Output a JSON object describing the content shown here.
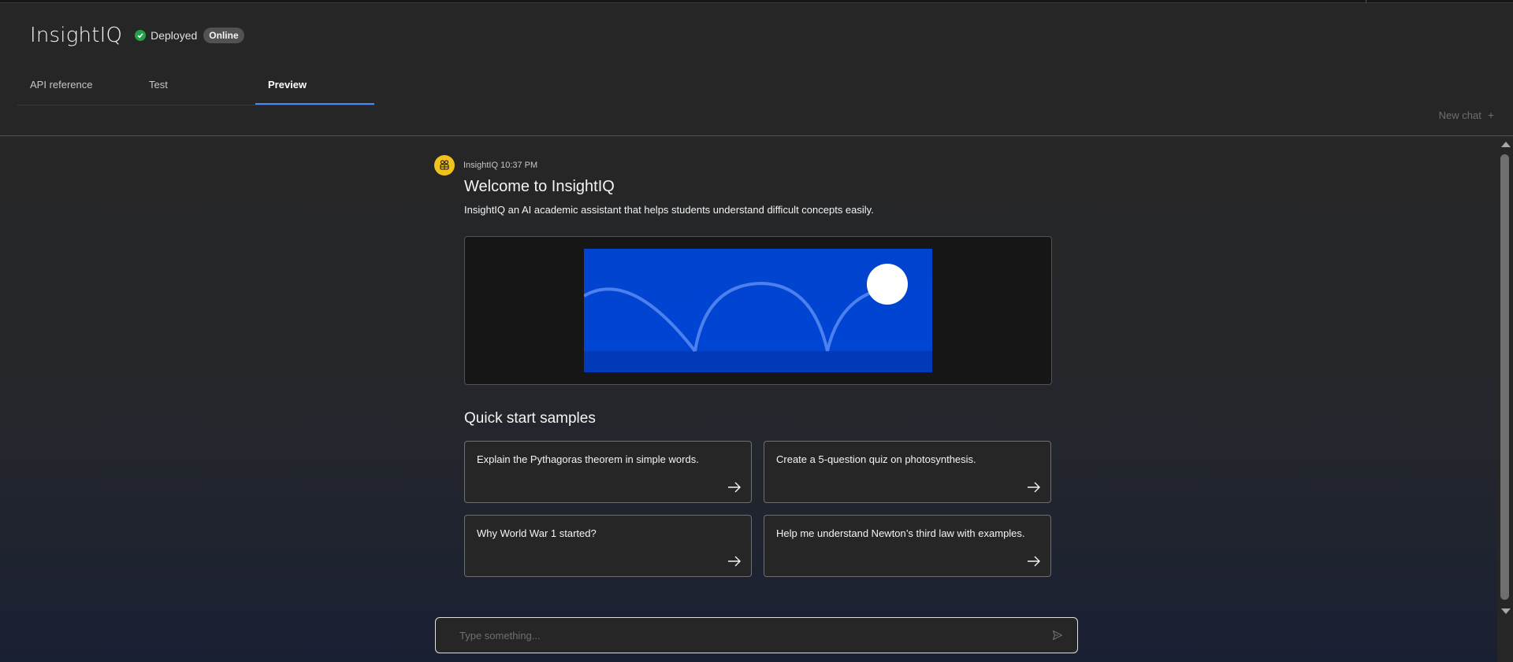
{
  "app": {
    "title": "InsightIQ",
    "status_label": "Deployed",
    "status_badge": "Online"
  },
  "tabs": [
    {
      "label": "API reference",
      "active": false
    },
    {
      "label": "Test",
      "active": false
    },
    {
      "label": "Preview",
      "active": true
    }
  ],
  "toolbar": {
    "new_chat_label": "New chat",
    "new_chat_icon": "plus-icon"
  },
  "message": {
    "sender": "InsightIQ",
    "time": "10:37 PM",
    "title": "Welcome to InsightIQ",
    "description": "InsightIQ an AI academic assistant that helps students understand difficult concepts easily."
  },
  "samples": {
    "title": "Quick start samples",
    "items": [
      "Explain the Pythagoras theorem in simple words.",
      "Create a 5-question quiz on photosynthesis.",
      "Why World War 1 started?",
      "Help me understand Newton’s third law with examples."
    ]
  },
  "input": {
    "placeholder": "Type something..."
  },
  "colors": {
    "accent": "#4589ff",
    "status_green": "#24a148",
    "avatar_yellow": "#f1c21b",
    "banner_blue": "#0043ce"
  }
}
